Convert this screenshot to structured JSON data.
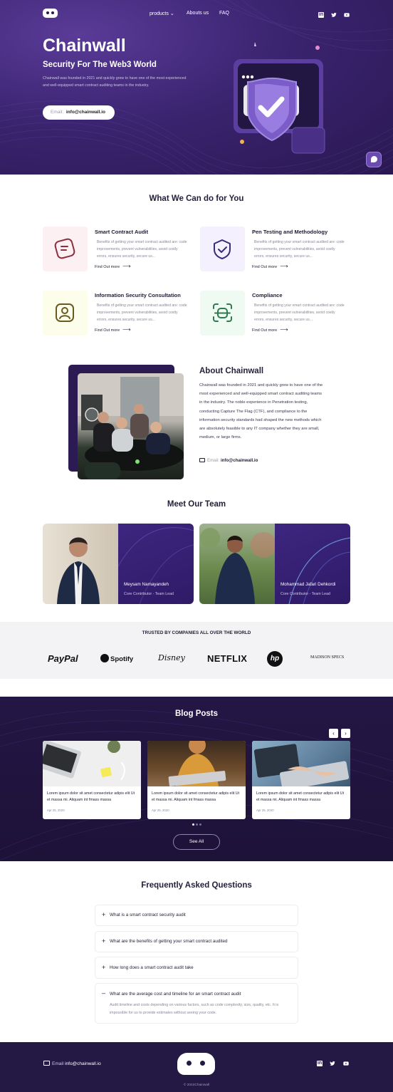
{
  "nav": {
    "products": "products",
    "about": "Abouts us",
    "faq": "FAQ",
    "social": [
      "in",
      "twitter",
      "youtube"
    ]
  },
  "hero": {
    "title": "Chainwall",
    "subtitle": "Security For The Web3 World",
    "description": "Chainwall was founded in 2021 and quickly grew to have one of the most experienced and well-equipped smart contract auditing teams in the industry.",
    "email_label": "Email:",
    "email_value": "info@chainwall.io"
  },
  "services": {
    "title": "What We Can do for You",
    "items": [
      {
        "name": "Smart Contract Audit",
        "description": "Benefits of getting your smart contract audited are: code improvements, prevent vulnerabilities, avoid costly errors, ensures security, secure us...",
        "link": "Find Out more",
        "icon": "document-icon"
      },
      {
        "name": "Pen Testing and Methodology",
        "description": "Benefits of getting your smart contract audited are: code improvements, prevent vulnerabilities, avoid costly errors, ensures security, secure us...",
        "link": "Find Out more",
        "icon": "shield-check-icon"
      },
      {
        "name": "Information Security Consultation",
        "description": "Benefits of getting your smart contract audited are: code improvements, prevent vulnerabilities, avoid costly errors, ensures security, secure us...",
        "link": "Find Out more",
        "icon": "user-badge-icon"
      },
      {
        "name": "Compliance",
        "description": "Benefits of getting your smart contract audited are: code improvements, prevent vulnerabilities, avoid costly errors, ensures security, secure us...",
        "link": "Find Out more",
        "icon": "scan-icon"
      }
    ]
  },
  "about": {
    "title": "About Chainwall",
    "text": "Chainwall was founded in 2021 and quickly grew to have one of the most experienced and well-equipped smart contract auditing teams in the industry. The noble experience in Penetration testing, conducting Capture The Flag (CTF), and compliance to the information security standards had shaped the new methods which are absolutely feasible to any IT company whether they are small, medium, or large firms.",
    "email_label": "Email:",
    "email_value": "info@chainwall.io"
  },
  "team": {
    "title": "Meet Our Team",
    "members": [
      {
        "name": "Meysam Namayandeh",
        "role": "Core Contributor - Team Lead"
      },
      {
        "name": "Mohammad Jafari Dehkordi",
        "role": "Core Contributor - Team Lead"
      }
    ]
  },
  "brands": {
    "title": "TRUSTED BY COMPANIES ALL OVER THE WORLD",
    "items": [
      "PayPal",
      "Spotify",
      "Disney",
      "NETFLIX",
      "hp",
      "MADISON SPECS"
    ]
  },
  "blog": {
    "title": "Blog Posts",
    "posts": [
      {
        "text": "Lorem ipsum dolor sit amet consectetur adipis elit Ut et massa mi. Aliquam int fmass massa",
        "date": "Apr 25, 2020"
      },
      {
        "text": "Lorem ipsum dolor sit amet consectetur adipis elit Ut et massa mi. Aliquam int fmass massa",
        "date": "Apr 25, 2020"
      },
      {
        "text": "Lorem ipsum dolor sit amet consectetur adipis elit Ut et massa mi. Aliquam int fmass massa",
        "date": "Apr 25, 2020"
      }
    ],
    "see_all": "See All",
    "prev": "‹",
    "next": "›"
  },
  "faq": {
    "title": "Frequently Asked Questions",
    "items": [
      {
        "question": "What is a smart contract security audit",
        "sign": "+"
      },
      {
        "question": "What are the benefits of getting your smart contract audited",
        "sign": "+"
      },
      {
        "question": "How long does a smart contract audit take",
        "sign": "+"
      },
      {
        "question": "What are the average cost and timeline for an smart contract audit",
        "sign": "–",
        "answer": "Audit timeline and costs depending on various factors, such as code complexity, size, quality, etc. It is impossible for us to provide estimates without seeing your code."
      }
    ]
  },
  "footer": {
    "email_label": "Email",
    "email_value": "info@chainwall.io",
    "copyright": "© 2022Chainwall"
  },
  "colors": {
    "hero_bg": "#3b2470",
    "accent": "#6c4bb0",
    "dark": "#241845"
  }
}
